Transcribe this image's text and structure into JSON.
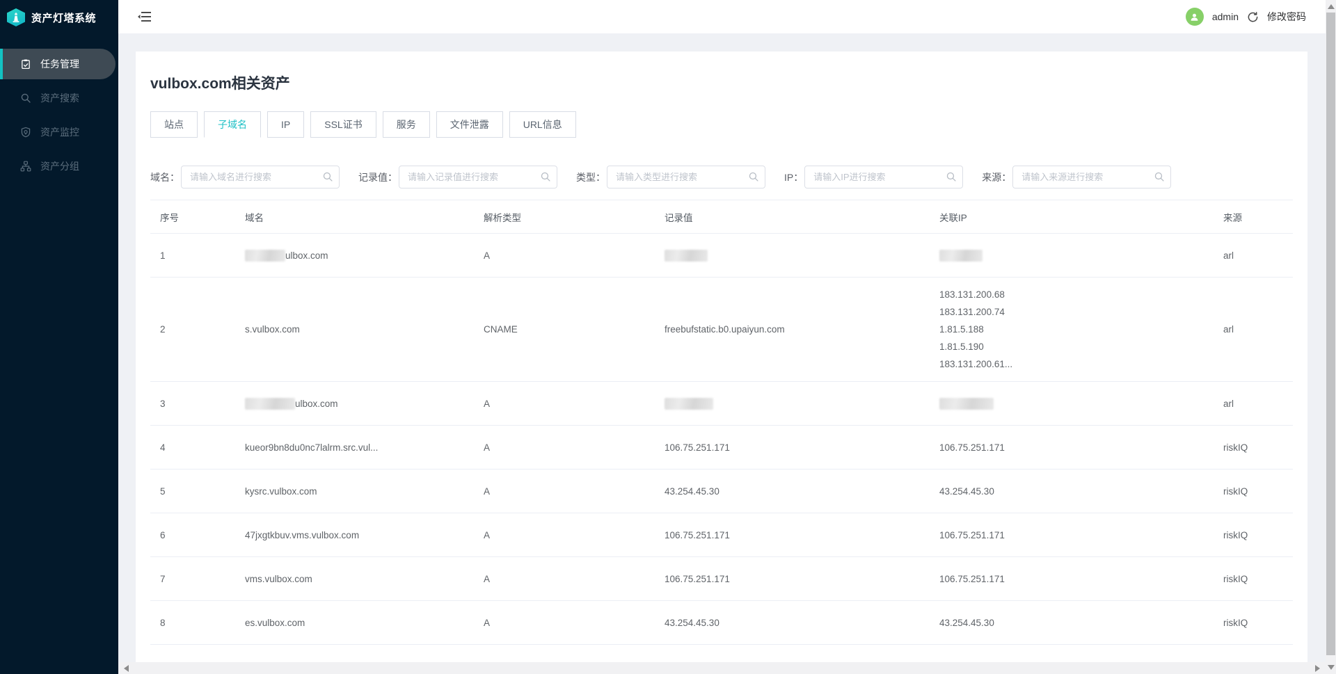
{
  "app": {
    "name": "资产灯塔系统"
  },
  "sidebar": {
    "items": [
      {
        "label": "任务管理",
        "icon": "tasks-clipboard-icon",
        "active": true
      },
      {
        "label": "资产搜索",
        "icon": "asset-search-icon",
        "active": false
      },
      {
        "label": "资产监控",
        "icon": "monitor-shield-icon",
        "active": false
      },
      {
        "label": "资产分组",
        "icon": "group-sitemap-icon",
        "active": false
      }
    ]
  },
  "topbar": {
    "username": "admin",
    "change_password_label": "修改密码"
  },
  "page": {
    "title": "vulbox.com相关资产"
  },
  "tabs": [
    {
      "label": "站点",
      "active": false
    },
    {
      "label": "子域名",
      "active": true
    },
    {
      "label": "IP",
      "active": false
    },
    {
      "label": "SSL证书",
      "active": false
    },
    {
      "label": "服务",
      "active": false
    },
    {
      "label": "文件泄露",
      "active": false
    },
    {
      "label": "URL信息",
      "active": false
    }
  ],
  "filters": [
    {
      "name": "domain",
      "label": "域名：",
      "placeholder": "请输入域名进行搜索",
      "value": ""
    },
    {
      "name": "record",
      "label": "记录值：",
      "placeholder": "请输入记录值进行搜索",
      "value": ""
    },
    {
      "name": "type",
      "label": "类型：",
      "placeholder": "请输入类型进行搜索",
      "value": ""
    },
    {
      "name": "ip",
      "label": "IP：",
      "placeholder": "请输入IP进行搜索",
      "value": ""
    },
    {
      "name": "source",
      "label": "来源：",
      "placeholder": "请输入来源进行搜索",
      "value": ""
    }
  ],
  "table": {
    "columns": [
      "序号",
      "域名",
      "解析类型",
      "记录值",
      "关联IP",
      "来源"
    ],
    "rows": [
      {
        "no": "1",
        "domain": {
          "redact_before": 58,
          "text": "ulbox.com"
        },
        "type": "A",
        "record": {
          "redact": 62
        },
        "ips": {
          "redact": 62
        },
        "source": "arl"
      },
      {
        "no": "2",
        "domain": {
          "text": "s.vulbox.com"
        },
        "type": "CNAME",
        "record": {
          "text": "freebufstatic.b0.upaiyun.com"
        },
        "ips": {
          "list": [
            "183.131.200.68",
            "183.131.200.74",
            "1.81.5.188",
            "1.81.5.190",
            "183.131.200.61..."
          ]
        },
        "source": "arl"
      },
      {
        "no": "3",
        "domain": {
          "redact_before": 72,
          "text": "ulbox.com"
        },
        "type": "A",
        "record": {
          "redact": 70
        },
        "ips": {
          "redact": 78
        },
        "source": "arl"
      },
      {
        "no": "4",
        "domain": {
          "text": "kueor9bn8du0nc7lalrm.src.vul..."
        },
        "type": "A",
        "record": {
          "text": "106.75.251.171"
        },
        "ips": {
          "list": [
            "106.75.251.171"
          ]
        },
        "source": "riskIQ"
      },
      {
        "no": "5",
        "domain": {
          "text": "kysrc.vulbox.com"
        },
        "type": "A",
        "record": {
          "text": "43.254.45.30"
        },
        "ips": {
          "list": [
            "43.254.45.30"
          ]
        },
        "source": "riskIQ"
      },
      {
        "no": "6",
        "domain": {
          "text": "47jxgtkbuv.vms.vulbox.com"
        },
        "type": "A",
        "record": {
          "text": "106.75.251.171"
        },
        "ips": {
          "list": [
            "106.75.251.171"
          ]
        },
        "source": "riskIQ"
      },
      {
        "no": "7",
        "domain": {
          "text": "vms.vulbox.com"
        },
        "type": "A",
        "record": {
          "text": "106.75.251.171"
        },
        "ips": {
          "list": [
            "106.75.251.171"
          ]
        },
        "source": "riskIQ"
      },
      {
        "no": "8",
        "domain": {
          "text": "es.vulbox.com"
        },
        "type": "A",
        "record": {
          "text": "43.254.45.30"
        },
        "ips": {
          "list": [
            "43.254.45.30"
          ]
        },
        "source": "riskIQ"
      }
    ]
  },
  "colors": {
    "accent_teal": "#13c2c2",
    "sidebar_bg": "#03192b",
    "avatar_green": "#87d068",
    "active_tab_text": "#1fc0c6",
    "page_bg": "#eff1f5"
  }
}
